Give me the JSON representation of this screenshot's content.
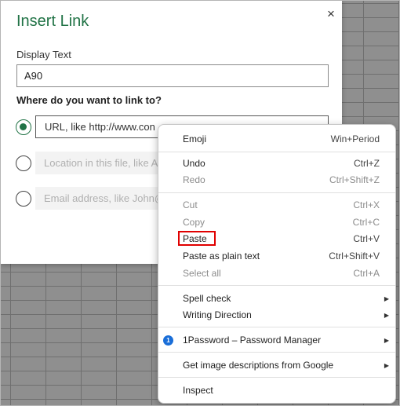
{
  "dialog": {
    "title": "Insert Link",
    "close_glyph": "×",
    "display_text_label": "Display Text",
    "display_text_value": "A90",
    "link_to_heading": "Where do you want to link to?",
    "url_placeholder": "URL, like http://www.con",
    "location_placeholder": "Location in this file, like A",
    "email_placeholder": "Email address, like John@"
  },
  "context_menu": {
    "emoji": {
      "label": "Emoji",
      "shortcut": "Win+Period"
    },
    "undo": {
      "label": "Undo",
      "shortcut": "Ctrl+Z"
    },
    "redo": {
      "label": "Redo",
      "shortcut": "Ctrl+Shift+Z"
    },
    "cut": {
      "label": "Cut",
      "shortcut": "Ctrl+X"
    },
    "copy": {
      "label": "Copy",
      "shortcut": "Ctrl+C"
    },
    "paste": {
      "label": "Paste",
      "shortcut": "Ctrl+V"
    },
    "paste_plain": {
      "label": "Paste as plain text",
      "shortcut": "Ctrl+Shift+V"
    },
    "select_all": {
      "label": "Select all",
      "shortcut": "Ctrl+A"
    },
    "spell_check": {
      "label": "Spell check"
    },
    "writing_direction": {
      "label": "Writing Direction"
    },
    "onepassword": {
      "label": "1Password – Password Manager",
      "icon_glyph": "1"
    },
    "image_descriptions": {
      "label": "Get image descriptions from Google"
    },
    "inspect": {
      "label": "Inspect"
    }
  },
  "colors": {
    "accent": "#217346",
    "highlight": "#e00000",
    "onepassword_blue": "#1a6ed8"
  }
}
